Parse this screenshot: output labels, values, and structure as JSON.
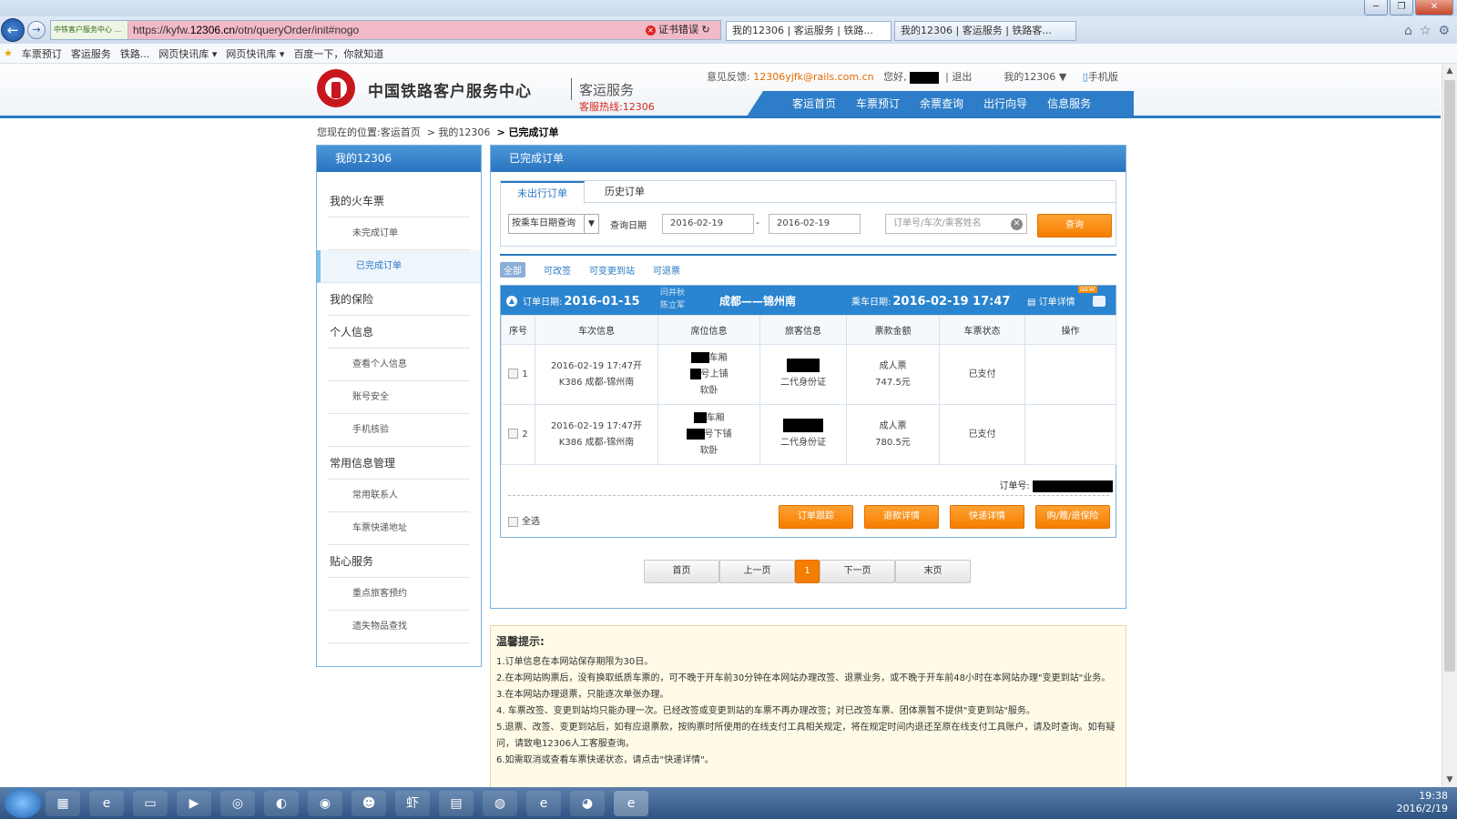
{
  "browser": {
    "site_label": "中铁客户服务中心 ...",
    "url_prefix": "https://kyfw.",
    "url_domain": "12306.cn",
    "url_path": "/otn/queryOrder/init#nogo",
    "cert_error": "证书错误",
    "tabs": [
      {
        "label": "我的12306 | 客运服务 | 铁路..."
      },
      {
        "label": "我的12306 | 客运服务 | 铁路客..."
      }
    ],
    "favorites": [
      "车票预订",
      "客运服务",
      "铁路...",
      "网页快讯库 ▾",
      "网页快讯库 ▾",
      "百度一下，你就知道"
    ]
  },
  "header": {
    "brand": "中国铁路客户服务中心",
    "sub_brand": "客运服务",
    "hotline": "客服热线:12306",
    "feedback_label": "意见反馈:",
    "feedback_email": "12306yjfk@rails.com.cn",
    "greeting": "您好,",
    "logout": "退出",
    "my12306": "我的12306",
    "mobile": "手机版",
    "nav": [
      "客运首页",
      "车票预订",
      "余票查询",
      "出行向导",
      "信息服务"
    ]
  },
  "breadcrumb": {
    "prefix": "您现在的位置:",
    "home": "客运首页",
    "mid": "> 我的12306",
    "current": "> 已完成订单"
  },
  "sidebar": {
    "title": "我的12306",
    "sections": [
      {
        "label": "我的火车票",
        "items": [
          "未完成订单",
          "已完成订单"
        ]
      },
      {
        "label": "我的保险",
        "items": []
      },
      {
        "label": "个人信息",
        "items": [
          "查看个人信息",
          "账号安全",
          "手机核验"
        ]
      },
      {
        "label": "常用信息管理",
        "items": [
          "常用联系人",
          "车票快递地址"
        ]
      },
      {
        "label": "贴心服务",
        "items": [
          "重点旅客预约",
          "遗失物品查找"
        ]
      }
    ]
  },
  "main": {
    "title": "已完成订单",
    "tabs": [
      "未出行订单",
      "历史订单"
    ],
    "query": {
      "mode": "按乘车日期查询",
      "date_label": "查询日期",
      "date_from": "2016-02-19",
      "date_to": "2016-02-19",
      "keyword_placeholder": "订单号/车次/乘客姓名",
      "search_button": "查询"
    },
    "filters": [
      "全部",
      "可改签",
      "可变更到站",
      "可退票"
    ]
  },
  "order": {
    "order_date_label": "订单日期:",
    "order_date": "2016-01-15",
    "passengers": [
      "闫井秋",
      "陈立军"
    ],
    "route": "成都——锦州南",
    "ride_date_label": "乘车日期:",
    "ride_date": "2016-02-19 17:47",
    "detail_link": "订单详情",
    "new_badge": "NEW",
    "columns": [
      "序号",
      "车次信息",
      "席位信息",
      "旅客信息",
      "票款金额",
      "车票状态",
      "操作"
    ],
    "rows": [
      {
        "no": "1",
        "train_time": "2016-02-19 17:47开",
        "train": "K386 成都-锦州南",
        "car": "车厢",
        "berth": "号上铺",
        "seat_type": "软卧",
        "id_type": "二代身份证",
        "ticket_type": "成人票",
        "price": "747.5元",
        "status": "已支付"
      },
      {
        "no": "2",
        "train_time": "2016-02-19 17:47开",
        "train": "K386 成都-锦州南",
        "car": "车厢",
        "berth": "号下铺",
        "seat_type": "软卧",
        "id_type": "二代身份证",
        "ticket_type": "成人票",
        "price": "780.5元",
        "status": "已支付"
      }
    ],
    "order_no_label": "订单号:",
    "select_all": "全选",
    "actions": [
      "订单跟踪",
      "退款详情",
      "快递详情",
      "购/赠/退保险"
    ]
  },
  "pager": {
    "first": "首页",
    "prev": "上一页",
    "current": "1",
    "next": "下一页",
    "last": "末页"
  },
  "tips": {
    "title": "温馨提示:",
    "items": [
      "1.订单信息在本网站保存期限为30日。",
      "2.在本网站购票后，没有换取纸质车票的，可不晚于开车前30分钟在本网站办理改签、退票业务，或不晚于开车前48小时在本网站办理\"变更到站\"业务。",
      "3.在本网站办理退票，只能逐次单张办理。",
      "4. 车票改签、变更到站均只能办理一次。已经改签或变更到站的车票不再办理改签；对已改签车票、团体票暂不提供\"变更到站\"服务。",
      "5.退票、改签、变更到站后，如有应退票款，按购票时所使用的在线支付工具相关规定，将在规定时间内退还至原在线支付工具账户，请及时查询。如有疑问，请致电12306人工客服查询。",
      "6.如需取消或查看车票快递状态，请点击\"快递详情\"。"
    ]
  },
  "taskbar": {
    "time": "19:38",
    "date": "2016/2/19"
  }
}
